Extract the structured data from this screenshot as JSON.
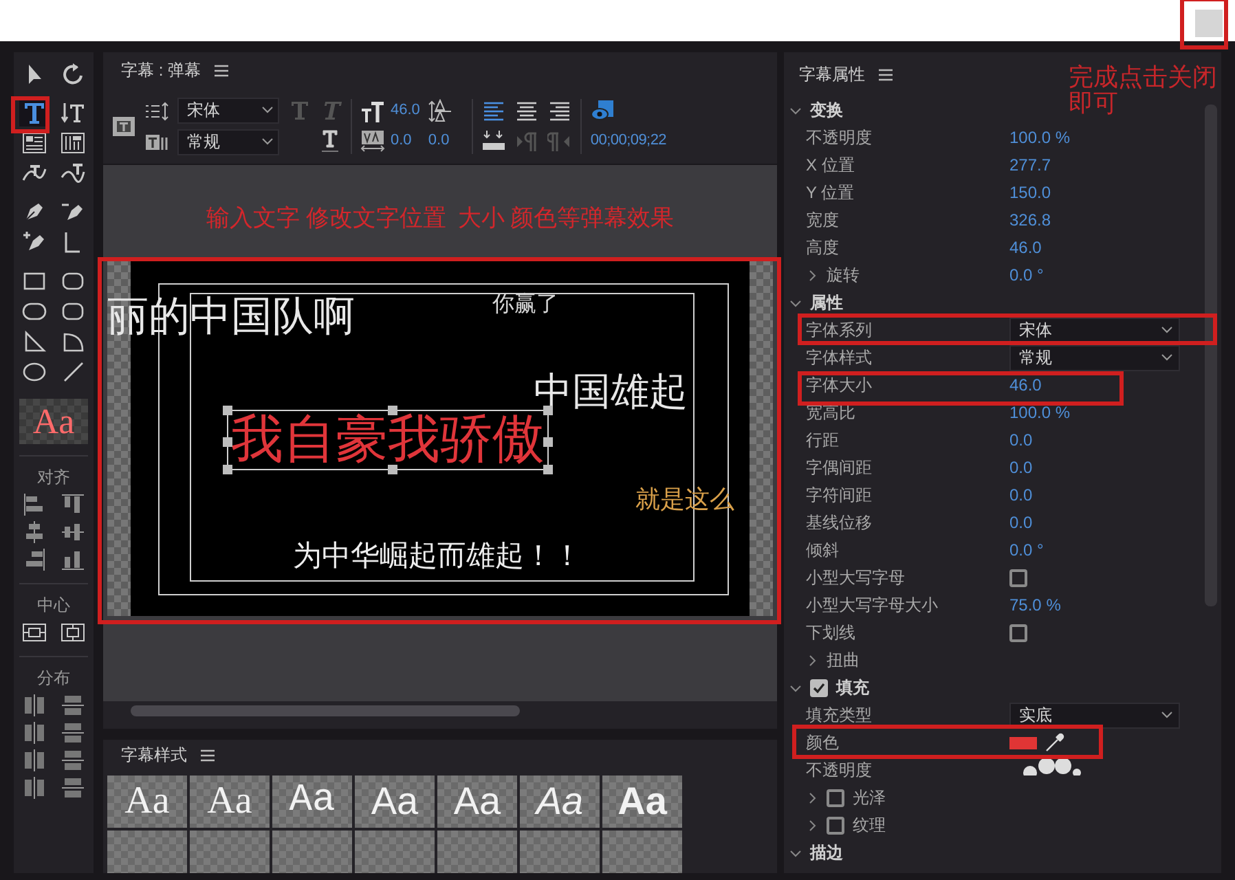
{
  "annotations": {
    "close_hint": "完成点击关闭即可",
    "edit_hint": "输入文字 修改文字位置  大小 颜色等弹幕效果"
  },
  "tools": [
    {
      "kind": "select",
      "selected": false
    },
    {
      "kind": "rotate",
      "selected": false
    },
    {
      "kind": "type",
      "selected": true
    },
    {
      "kind": "vertical-type",
      "selected": false
    },
    {
      "kind": "area-type",
      "selected": false
    },
    {
      "kind": "vertical-area-type",
      "selected": false
    },
    {
      "kind": "path-type",
      "selected": false
    },
    {
      "kind": "vertical-path-type",
      "selected": false
    },
    {
      "kind": "pen",
      "selected": false
    },
    {
      "kind": "delete-anchor",
      "selected": false
    },
    {
      "kind": "add-anchor",
      "selected": false
    },
    {
      "kind": "convert-anchor",
      "selected": false
    },
    {
      "kind": "rectangle",
      "selected": false
    },
    {
      "kind": "rounded-rectangle",
      "selected": false
    },
    {
      "kind": "ellipse-rectangle",
      "selected": false
    },
    {
      "kind": "rounded-rectangle",
      "selected": false
    },
    {
      "kind": "wedge",
      "selected": false
    },
    {
      "kind": "arc",
      "selected": false
    },
    {
      "kind": "ellipse",
      "selected": false
    },
    {
      "kind": "line",
      "selected": false
    }
  ],
  "style_preview": "Aa",
  "layout_groups": [
    {
      "label": "对齐",
      "icons": [
        {
          "kind": "align-left"
        },
        {
          "kind": "align-top"
        },
        {
          "kind": "align-hcenter"
        },
        {
          "kind": "align-vcenter"
        },
        {
          "kind": "align-right"
        },
        {
          "kind": "align-bottom"
        }
      ]
    },
    {
      "label": "中心",
      "icons": [
        {
          "kind": "center-h"
        },
        {
          "kind": "center-v"
        }
      ]
    },
    {
      "label": "分布",
      "icons": [
        {
          "kind": "dist-v"
        },
        {
          "kind": "dist-h"
        },
        {
          "kind": "dist-v"
        },
        {
          "kind": "dist-h"
        },
        {
          "kind": "dist-v"
        },
        {
          "kind": "dist-h"
        },
        {
          "kind": "dist-v"
        },
        {
          "kind": "dist-h"
        }
      ]
    }
  ],
  "editor": {
    "title": "字幕 : 弹幕",
    "font_family": "宋体",
    "font_style": "常规",
    "font_size": "46.0",
    "kerning": "0.0",
    "leading": "0.0",
    "timecode": "00;00;09;22",
    "text_align": [
      {
        "kind": "left",
        "selected": true
      },
      {
        "kind": "center",
        "selected": false
      },
      {
        "kind": "right",
        "selected": false
      }
    ],
    "texts": [
      {
        "text": "丽的中国队啊",
        "color": "#e8e8e8",
        "selected": false
      },
      {
        "text": "你赢了",
        "color": "#d8d8d8",
        "selected": false
      },
      {
        "text": "中国雄起",
        "color": "#e8e8e8",
        "selected": false
      },
      {
        "text": "我自豪我骄傲",
        "color": "#e0353a",
        "selected": true
      },
      {
        "text": "就是这么",
        "color": "#d9a04a",
        "selected": false
      },
      {
        "text": "为中华崛起而雄起！！",
        "color": "#eeeeee",
        "selected": false
      }
    ]
  },
  "styles": {
    "title": "字幕样式",
    "tiles": [
      {
        "label": "Aa",
        "kind": "serif"
      },
      {
        "label": "Aa",
        "kind": "serif"
      },
      {
        "label": "Aa",
        "kind": "mono"
      },
      {
        "label": "Aa",
        "kind": "sans"
      },
      {
        "label": "Aa",
        "kind": "sans"
      },
      {
        "label": "Aa",
        "kind": "italic"
      },
      {
        "label": "Aa",
        "kind": "bold"
      }
    ]
  },
  "properties": {
    "title": "字幕属性",
    "rows": [
      {
        "kind": "section",
        "label": "变换",
        "expanded": true
      },
      {
        "kind": "value",
        "label": "不透明度",
        "value": "100.0 %"
      },
      {
        "kind": "value",
        "label": "X 位置",
        "value": "277.7"
      },
      {
        "kind": "value",
        "label": "Y 位置",
        "value": "150.0"
      },
      {
        "kind": "value",
        "label": "宽度",
        "value": "326.8"
      },
      {
        "kind": "value",
        "label": "高度",
        "value": "46.0"
      },
      {
        "kind": "group",
        "label": "旋转",
        "value": "0.0 °",
        "expanded": false
      },
      {
        "kind": "section",
        "label": "属性",
        "expanded": true
      },
      {
        "kind": "dropdown",
        "label": "字体系列",
        "value": "宋体"
      },
      {
        "kind": "dropdown",
        "label": "字体样式",
        "value": "常规"
      },
      {
        "kind": "value",
        "label": "字体大小",
        "value": "46.0"
      },
      {
        "kind": "value",
        "label": "宽高比",
        "value": "100.0 %"
      },
      {
        "kind": "value",
        "label": "行距",
        "value": "0.0"
      },
      {
        "kind": "value",
        "label": "字偶间距",
        "value": "0.0"
      },
      {
        "kind": "value",
        "label": "字符间距",
        "value": "0.0"
      },
      {
        "kind": "value",
        "label": "基线位移",
        "value": "0.0"
      },
      {
        "kind": "value",
        "label": "倾斜",
        "value": "0.0 °"
      },
      {
        "kind": "checkbox",
        "label": "小型大写字母",
        "checked": false
      },
      {
        "kind": "value",
        "label": "小型大写字母大小",
        "value": "75.0 %"
      },
      {
        "kind": "checkbox",
        "label": "下划线",
        "checked": false
      },
      {
        "kind": "group",
        "label": "扭曲",
        "expanded": false
      },
      {
        "kind": "section",
        "label": "填充",
        "expanded": true,
        "checked": true
      },
      {
        "kind": "dropdown",
        "label": "填充类型",
        "value": "实底"
      },
      {
        "kind": "color",
        "label": "颜色",
        "color": "#e03535"
      },
      {
        "kind": "value",
        "label": "不透明度"
      },
      {
        "kind": "group",
        "label": "光泽",
        "expanded": false,
        "checked": false
      },
      {
        "kind": "group",
        "label": "纹理",
        "expanded": false,
        "checked": false
      },
      {
        "kind": "section",
        "label": "描边",
        "expanded": true
      }
    ]
  }
}
